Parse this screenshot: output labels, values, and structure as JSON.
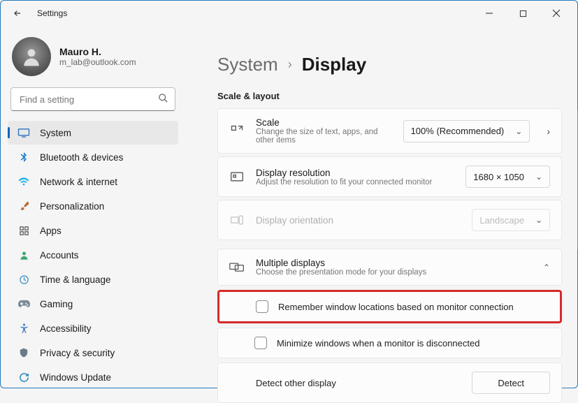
{
  "window": {
    "title": "Settings"
  },
  "user": {
    "name": "Mauro H.",
    "email": "m_lab@outlook.com"
  },
  "search": {
    "placeholder": "Find a setting"
  },
  "sidebar": {
    "items": [
      {
        "label": "System"
      },
      {
        "label": "Bluetooth & devices"
      },
      {
        "label": "Network & internet"
      },
      {
        "label": "Personalization"
      },
      {
        "label": "Apps"
      },
      {
        "label": "Accounts"
      },
      {
        "label": "Time & language"
      },
      {
        "label": "Gaming"
      },
      {
        "label": "Accessibility"
      },
      {
        "label": "Privacy & security"
      },
      {
        "label": "Windows Update"
      }
    ]
  },
  "breadcrumb": {
    "parent": "System",
    "current": "Display"
  },
  "section_title": "Scale & layout",
  "cards": {
    "scale": {
      "title": "Scale",
      "desc": "Change the size of text, apps, and other items",
      "value": "100% (Recommended)"
    },
    "resolution": {
      "title": "Display resolution",
      "desc": "Adjust the resolution to fit your connected monitor",
      "value": "1680 × 1050"
    },
    "orientation": {
      "title": "Display orientation",
      "value": "Landscape"
    },
    "multi": {
      "title": "Multiple displays",
      "desc": "Choose the presentation mode for your displays"
    },
    "remember": {
      "label": "Remember window locations based on monitor connection"
    },
    "minimize": {
      "label": "Minimize windows when a monitor is disconnected"
    },
    "detect": {
      "title": "Detect other display",
      "button": "Detect"
    }
  }
}
